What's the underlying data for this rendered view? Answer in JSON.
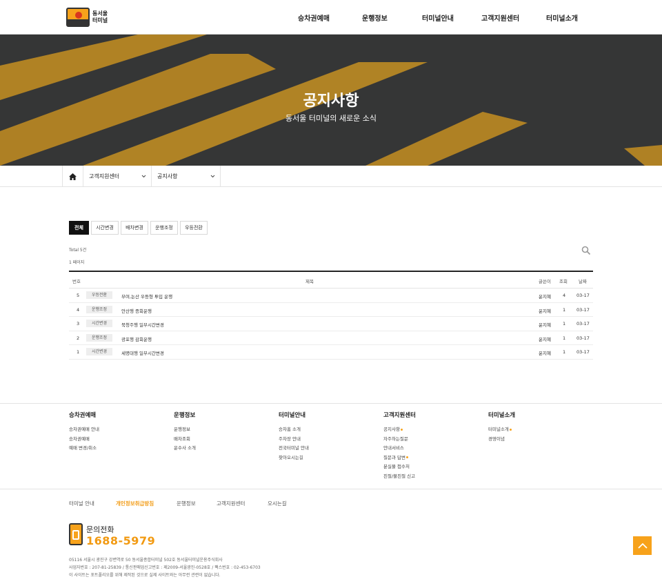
{
  "header": {
    "logo_line1": "동서울",
    "logo_line2": "터미널",
    "nav": [
      "승차권예매",
      "운행정보",
      "터미널안내",
      "고객지원센터",
      "터미널소개"
    ]
  },
  "hero": {
    "title": "공지사항",
    "subtitle": "동서울 터미널의 새로운 소식"
  },
  "breadcrumb": {
    "level1": "고객지원센터",
    "level2": "공지사항"
  },
  "tabs": [
    "전체",
    "시간변경",
    "배차변경",
    "운행조정",
    "우등전환"
  ],
  "list_info": {
    "total": "Total 5건",
    "page": "1 페이지"
  },
  "table": {
    "headers": {
      "num": "번호",
      "title": "제목",
      "author": "글쓴이",
      "views": "조회",
      "date": "날짜"
    },
    "rows": [
      {
        "num": "5",
        "category": "우등전환",
        "title": "부여,논산 우등형 투입 운행",
        "author": "윤지혜",
        "views": "4",
        "date": "03-17"
      },
      {
        "num": "4",
        "category": "운행조정",
        "title": "안산행 증회운행",
        "author": "윤지혜",
        "views": "1",
        "date": "03-17"
      },
      {
        "num": "3",
        "category": "시간변경",
        "title": "북청주행 일부시간변경",
        "author": "윤지혜",
        "views": "1",
        "date": "03-17"
      },
      {
        "num": "2",
        "category": "운행조정",
        "title": "광포행 감회운행",
        "author": "윤지혜",
        "views": "1",
        "date": "03-17"
      },
      {
        "num": "1",
        "category": "시간변경",
        "title": "세명대행 일부시간변경",
        "author": "윤지혜",
        "views": "1",
        "date": "03-17"
      }
    ]
  },
  "sitemap": [
    {
      "title": "승차권예매",
      "links": [
        {
          "label": "승차권예매 안내"
        },
        {
          "label": "승차권예매"
        },
        {
          "label": "예매 변경/취소"
        }
      ]
    },
    {
      "title": "운행정보",
      "links": [
        {
          "label": "운행정보"
        },
        {
          "label": "배차조회"
        },
        {
          "label": "운수사 소개"
        }
      ]
    },
    {
      "title": "터미널안내",
      "links": [
        {
          "label": "승차홈 소개"
        },
        {
          "label": "주차장 안내"
        },
        {
          "label": "전국터미널 안내"
        },
        {
          "label": "찾아오시는길"
        }
      ]
    },
    {
      "title": "고객지원센터",
      "links": [
        {
          "label": "공지사항",
          "dot": true
        },
        {
          "label": "자주하는질문"
        },
        {
          "label": "안내서비스"
        },
        {
          "label": "질문과 답변",
          "dot": true
        },
        {
          "label": "분실물 접수처"
        },
        {
          "label": "친절/불친절 신고"
        }
      ]
    },
    {
      "title": "터미널소개",
      "links": [
        {
          "label": "터미널소개",
          "dot": true
        },
        {
          "label": "경영이념"
        }
      ]
    }
  ],
  "footer_nav": [
    "터미널 안내",
    "개인정보취급방침",
    "운행정보",
    "고객지원센터",
    "오시는길"
  ],
  "contact": {
    "label": "문의전화",
    "number": "1688-5979"
  },
  "address": {
    "line1": "05116 서울시 광진구 강변역로 50 동서울종합터미널 502호 동서울터미널운용주식회사",
    "line2": "사업자번호 : 207-81-25839 / 통신판매업신고번호 : 제2009-서울광진-0528호 / 팩스번호 : 02-453-6703",
    "line3": "이 사이트는 포트폴리오를 위해 제작된 것으로 실제 사이트와는 아무런 관련이 없습니다."
  },
  "colors": {
    "accent": "#f7a21b",
    "accent_text": "#f29a12",
    "dark": "#111111"
  },
  "icons": {
    "home": "home-icon",
    "search": "search-icon",
    "chevron": "chevron-down-icon",
    "top": "arrow-up-icon",
    "phone": "phone-icon"
  }
}
